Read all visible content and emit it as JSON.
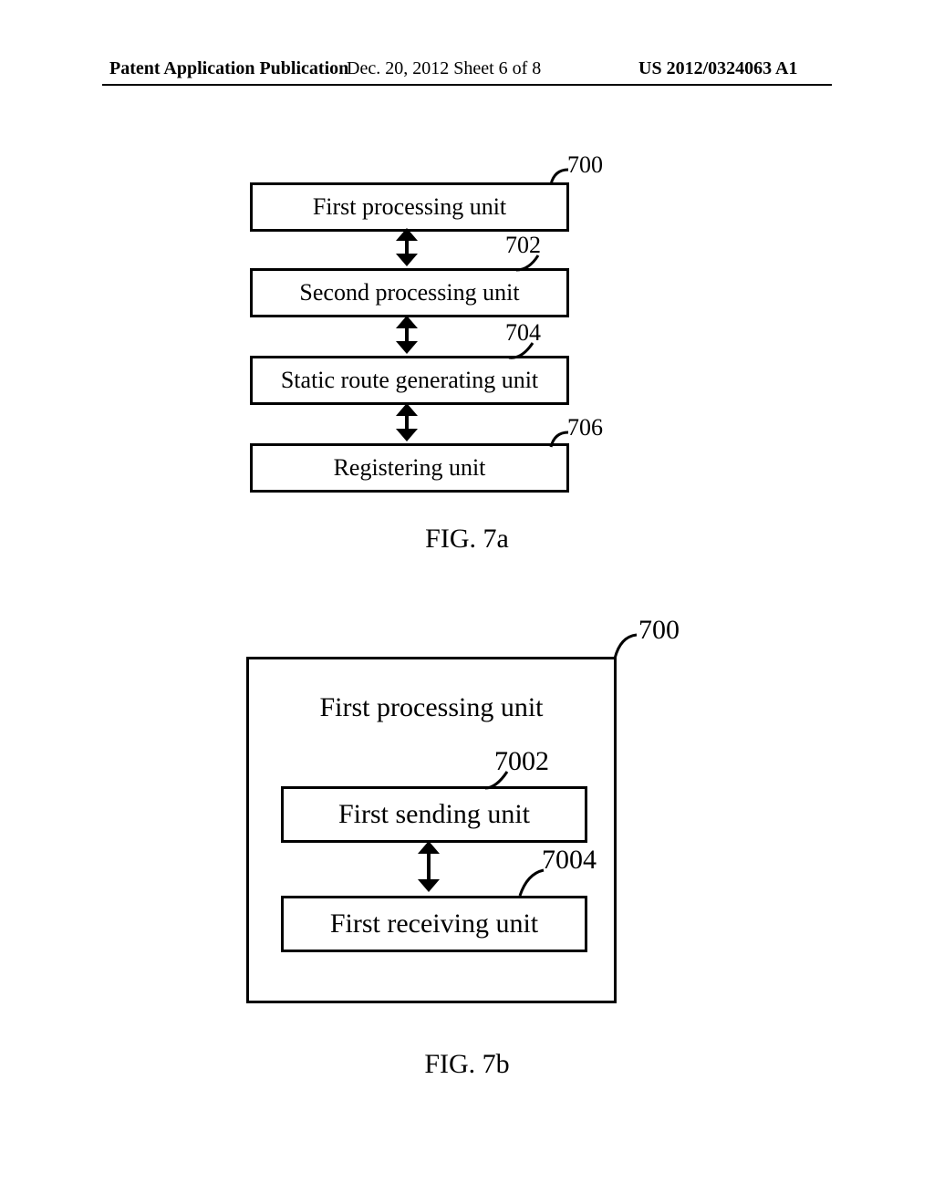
{
  "header": {
    "left": "Patent Application Publication",
    "mid": "Dec. 20, 2012  Sheet 6 of 8",
    "right": "US 2012/0324063 A1"
  },
  "fig7a": {
    "caption": "FIG. 7a",
    "blocks": {
      "b700": "First processing unit",
      "b702": "Second processing unit",
      "b704": "Static route generating unit",
      "b706": "Registering unit"
    },
    "refs": {
      "r700": "700",
      "r702": "702",
      "r704": "704",
      "r706": "706"
    }
  },
  "fig7b": {
    "caption": "FIG. 7b",
    "outer_title": "First processing unit",
    "blocks": {
      "b7002": "First sending unit",
      "b7004": "First receiving unit"
    },
    "refs": {
      "r700": "700",
      "r7002": "7002",
      "r7004": "7004"
    }
  }
}
